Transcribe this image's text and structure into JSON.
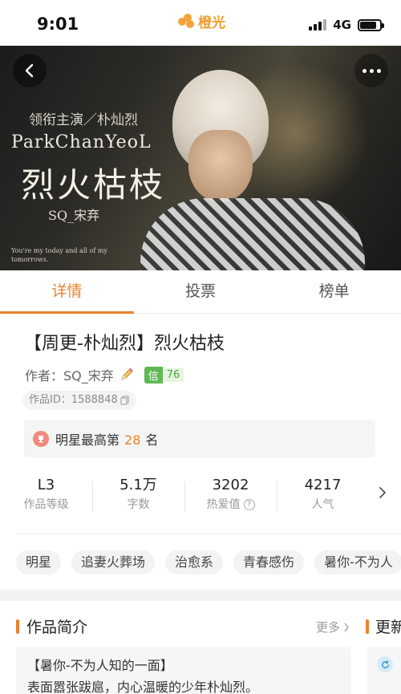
{
  "status_bar": {
    "time": "9:01",
    "app_name": "橙光",
    "network": "4G"
  },
  "hero": {
    "subtitle": "领衔主演／朴灿烈",
    "name": "ParkChanYeoL",
    "title": "烈火枯枝",
    "author": "SQ_宋弃",
    "small_text": "You're my today and all of my tomorrows."
  },
  "tabs": [
    {
      "label": "详情",
      "active": true
    },
    {
      "label": "投票",
      "active": false
    },
    {
      "label": "榜单",
      "active": false
    }
  ],
  "work": {
    "title": "【周更-朴灿烈】烈火枯枝",
    "author_label": "作者：SQ_宋弃",
    "credit_label": "信",
    "credit_value": "76",
    "id_label": "作品ID：1588848"
  },
  "rank": {
    "prefix": "明星最高第",
    "value": "28",
    "suffix": "名"
  },
  "stats": [
    {
      "value": "L3",
      "label": "作品等级"
    },
    {
      "value": "5.1万",
      "label": "字数"
    },
    {
      "value": "3202",
      "label": "热爱值"
    },
    {
      "value": "4217",
      "label": "人气"
    }
  ],
  "tags": [
    "明星",
    "追妻火葬场",
    "治愈系",
    "青春感伤",
    "暑你-不为人"
  ],
  "intro": {
    "header": "作品简介",
    "more": "更多",
    "line1": "【暑你-不为人知的一面】",
    "line2": "表面嚣张跋扈，内心温暖的少年朴灿烈。"
  },
  "update": {
    "header": "更新"
  },
  "colors": {
    "accent": "#e8822d",
    "credit_green": "#5fb853"
  }
}
